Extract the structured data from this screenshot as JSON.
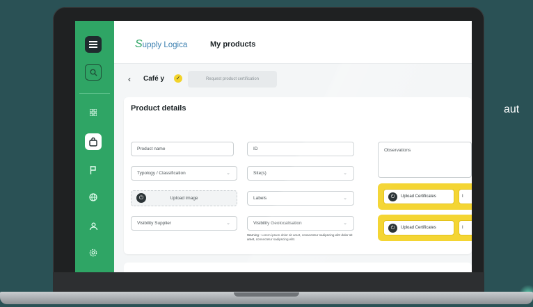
{
  "side_text": "aut",
  "header": {
    "logo_text": "upply Logica",
    "logo_letter": "S",
    "page_title": "My products"
  },
  "breadcrumb": {
    "back_icon": "‹",
    "product": "Café y",
    "request_button": "Request product certification"
  },
  "product_details": {
    "title": "Product details",
    "fields": {
      "product_name": "Product name",
      "id": "ID",
      "typology": "Typology / Classification",
      "site": "Site(s)",
      "upload_image": "Upload image",
      "labels": "Labels",
      "visibility_supplier": "Visibility Supplier",
      "visibility_geo": "Visibility Geolocalisation",
      "observations": "Observations"
    },
    "warning": "Warning : Lorem ipsum dolor sit amet, consectetur sadipscing elitr dolor sit amet, consectetur sadipscing elitr.",
    "upload_certificates": [
      "Upload Certificates",
      "Upload Certificates"
    ],
    "stub_text": "I"
  },
  "colors": {
    "sidebar": "#2fa565",
    "accent_yellow": "#f4d533",
    "background": "#2a5155"
  },
  "icons": {
    "menu": "menu-icon",
    "search": "search-icon",
    "grid": "grid-icon",
    "products": "bag-icon",
    "flag": "flag-icon",
    "globe": "globe-icon",
    "users": "users-icon",
    "settings": "gear-icon"
  }
}
